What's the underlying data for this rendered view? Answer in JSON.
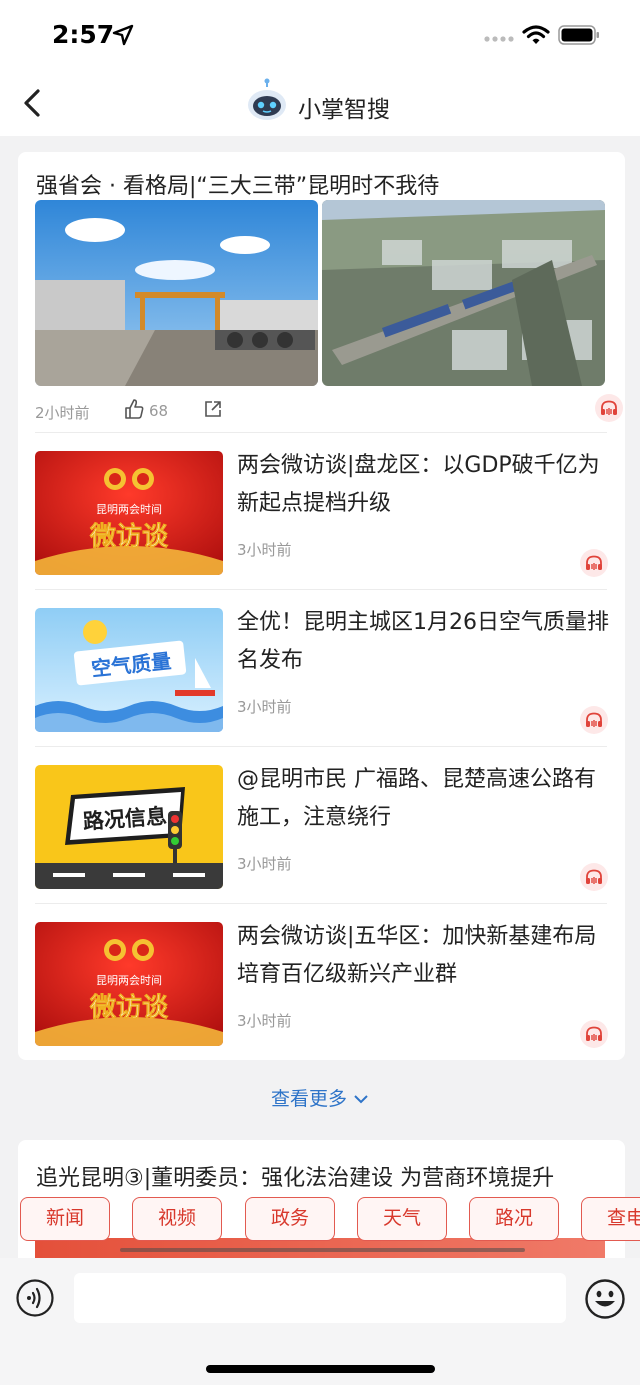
{
  "status_bar": {
    "time": "2:57"
  },
  "nav": {
    "title": "小掌智搜"
  },
  "lead": {
    "title": "强省会 · 看格局|“三大三带”昆明时不我待",
    "time": "2小时前",
    "likes": "68"
  },
  "news": [
    {
      "title": "两会微访谈|盘龙区：以GDP破千亿为新起点提档升级",
      "time": "3小时前",
      "thumb_caption": "昆明两会时间",
      "thumb_text": "微访谈"
    },
    {
      "title": "全优！昆明主城区1月26日空气质量排名发布",
      "time": "3小时前",
      "thumb_text": "空气质量"
    },
    {
      "title": "@昆明市民 广福路、昆楚高速公路有施工，注意绕行",
      "time": "3小时前",
      "thumb_text": "路况信息"
    },
    {
      "title": "两会微访谈|五华区：加快新基建布局 培育百亿级新兴产业群",
      "time": "3小时前",
      "thumb_caption": "昆明两会时间",
      "thumb_text": "微访谈"
    }
  ],
  "more_label": "查看更多",
  "card2": {
    "title": "追光昆明③|董明委员：强化法治建设 为营商环境提升"
  },
  "chips": [
    "新闻",
    "视频",
    "政务",
    "天气",
    "路况",
    "查电"
  ],
  "colors": {
    "accent": "#2e74c8",
    "chip_red": "#d8382c",
    "background": "#f2f2f3"
  },
  "icons": [
    "location-arrow-icon",
    "wifi-icon",
    "battery-icon",
    "back-chevron-icon",
    "robot-logo-icon",
    "thumbs-up-icon",
    "share-icon",
    "headphones-icon",
    "chevron-down-icon",
    "voice-icon",
    "emoji-icon"
  ]
}
